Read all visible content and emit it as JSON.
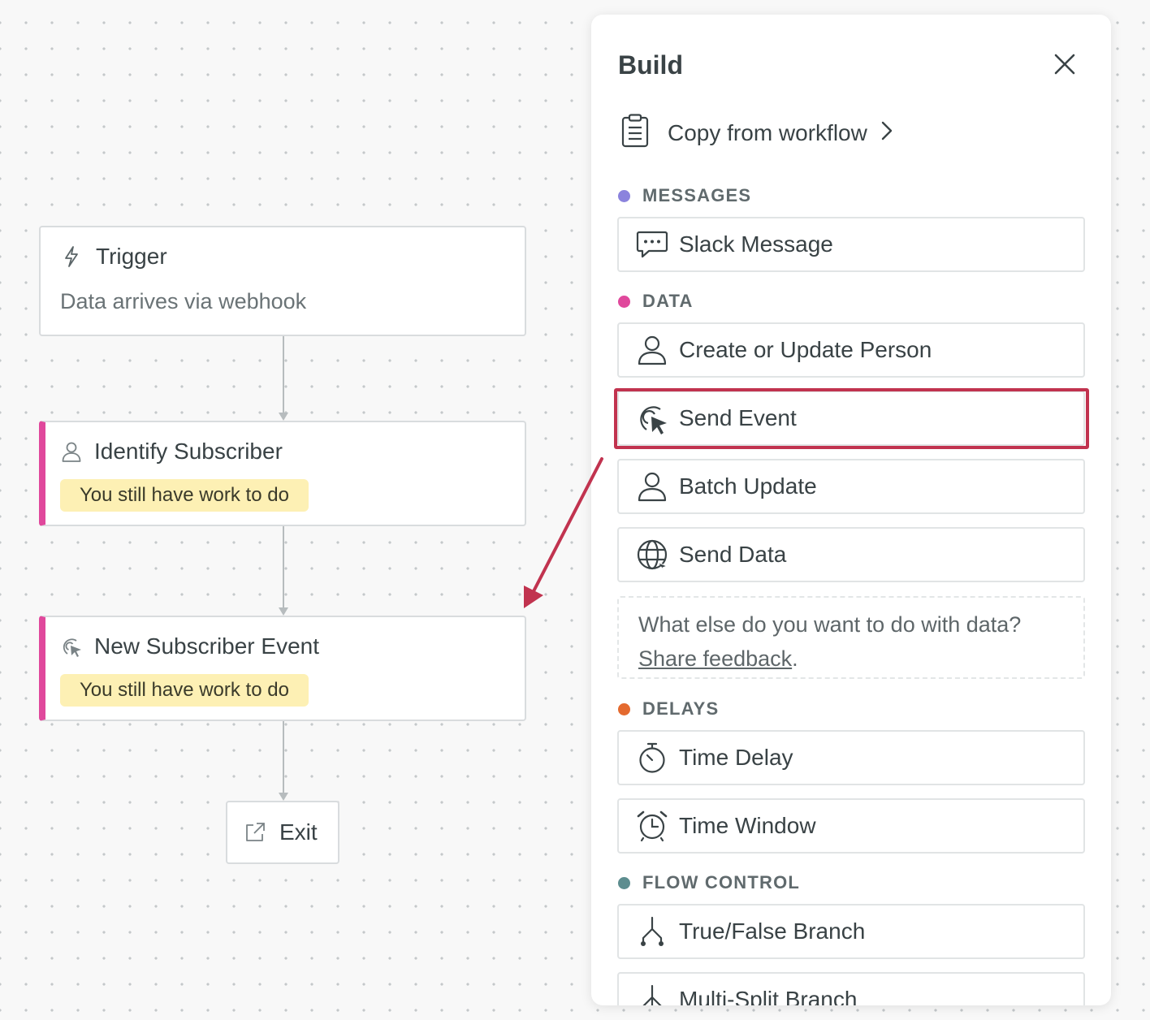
{
  "canvas": {
    "trigger": {
      "title": "Trigger",
      "subtitle": "Data arrives via webhook",
      "icon": "lightning-icon"
    },
    "identify": {
      "title": "Identify Subscriber",
      "status": "You still have work to do",
      "icon": "person-icon"
    },
    "event": {
      "title": "New Subscriber Event",
      "status": "You still have work to do",
      "icon": "event-cursor-icon"
    },
    "exit": {
      "label": "Exit",
      "icon": "external-link-icon"
    }
  },
  "panel": {
    "title": "Build",
    "copy_label": "Copy from workflow",
    "sections": {
      "messages": {
        "label": "MESSAGES",
        "color": "#8b83dd",
        "items": [
          {
            "label": "Slack Message",
            "icon": "chat-bubble-icon"
          }
        ]
      },
      "data": {
        "label": "DATA",
        "color": "#e0489c",
        "items": [
          {
            "label": "Create or Update Person",
            "icon": "person-icon"
          },
          {
            "label": "Send Event",
            "icon": "event-cursor-icon"
          },
          {
            "label": "Batch Update",
            "icon": "person-icon"
          },
          {
            "label": "Send Data",
            "icon": "globe-icon"
          }
        ],
        "feedback_text": "What else do you want to do with data?",
        "feedback_link": "Share feedback",
        "feedback_period": "."
      },
      "delays": {
        "label": "DELAYS",
        "color": "#e46a2f",
        "items": [
          {
            "label": "Time Delay",
            "icon": "stopwatch-icon"
          },
          {
            "label": "Time Window",
            "icon": "alarm-clock-icon"
          }
        ]
      },
      "flow_control": {
        "label": "FLOW CONTROL",
        "color": "#5d8d8f",
        "items": [
          {
            "label": "True/False Branch",
            "icon": "branch-icon"
          },
          {
            "label": "Multi-Split Branch",
            "icon": "multi-branch-icon"
          }
        ]
      }
    }
  },
  "colors": {
    "annotation": "#c1334f",
    "pending_bar": "#e0489c",
    "todo_badge": "#fdf0b4"
  }
}
